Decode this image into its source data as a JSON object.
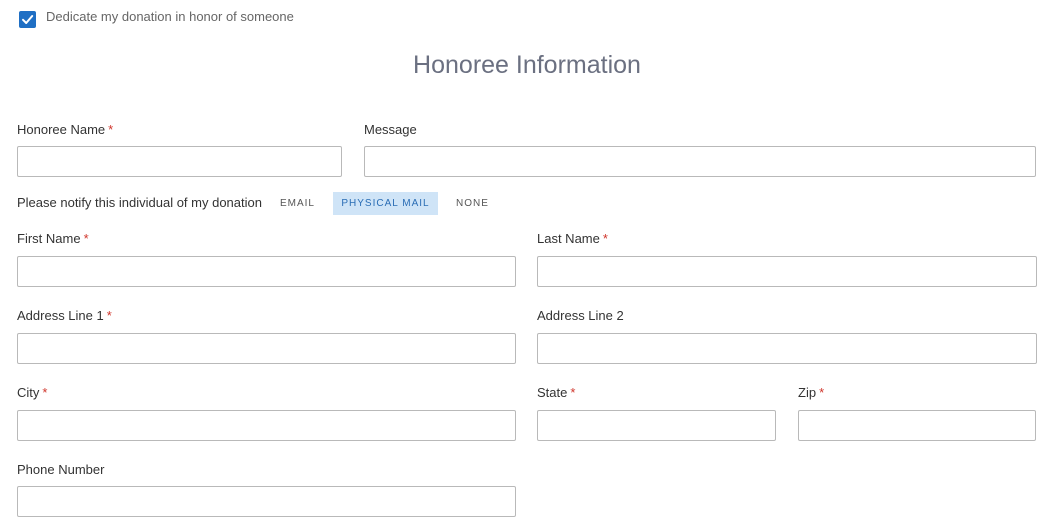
{
  "dedicate": {
    "checked": true,
    "label": "Dedicate my donation in honor of someone"
  },
  "section_title": "Honoree Information",
  "fields": {
    "honoree_name": {
      "label": "Honoree Name",
      "required_mark": "*",
      "value": ""
    },
    "message": {
      "label": "Message",
      "value": ""
    },
    "first_name": {
      "label": "First Name",
      "required_mark": "*",
      "value": ""
    },
    "last_name": {
      "label": "Last Name",
      "required_mark": "*",
      "value": ""
    },
    "address_line_1": {
      "label": "Address Line 1",
      "required_mark": "*",
      "value": ""
    },
    "address_line_2": {
      "label": "Address Line 2",
      "value": ""
    },
    "city": {
      "label": "City",
      "required_mark": "*",
      "value": ""
    },
    "state": {
      "label": "State",
      "required_mark": "*",
      "value": ""
    },
    "zip": {
      "label": "Zip",
      "required_mark": "*",
      "value": ""
    },
    "phone": {
      "label": "Phone Number",
      "value": ""
    }
  },
  "notify": {
    "label": "Please notify this individual of my donation",
    "options": [
      "EMAIL",
      "PHYSICAL MAIL",
      "NONE"
    ],
    "selected": "PHYSICAL MAIL"
  },
  "colors": {
    "checkbox": "#1f6fc4",
    "required": "#d0352b",
    "selected_option_bg": "#cfe4f7",
    "selected_option_text": "#2a6db5",
    "title": "#6b7081"
  },
  "icons": {
    "checkbox": "checkmark-icon"
  }
}
